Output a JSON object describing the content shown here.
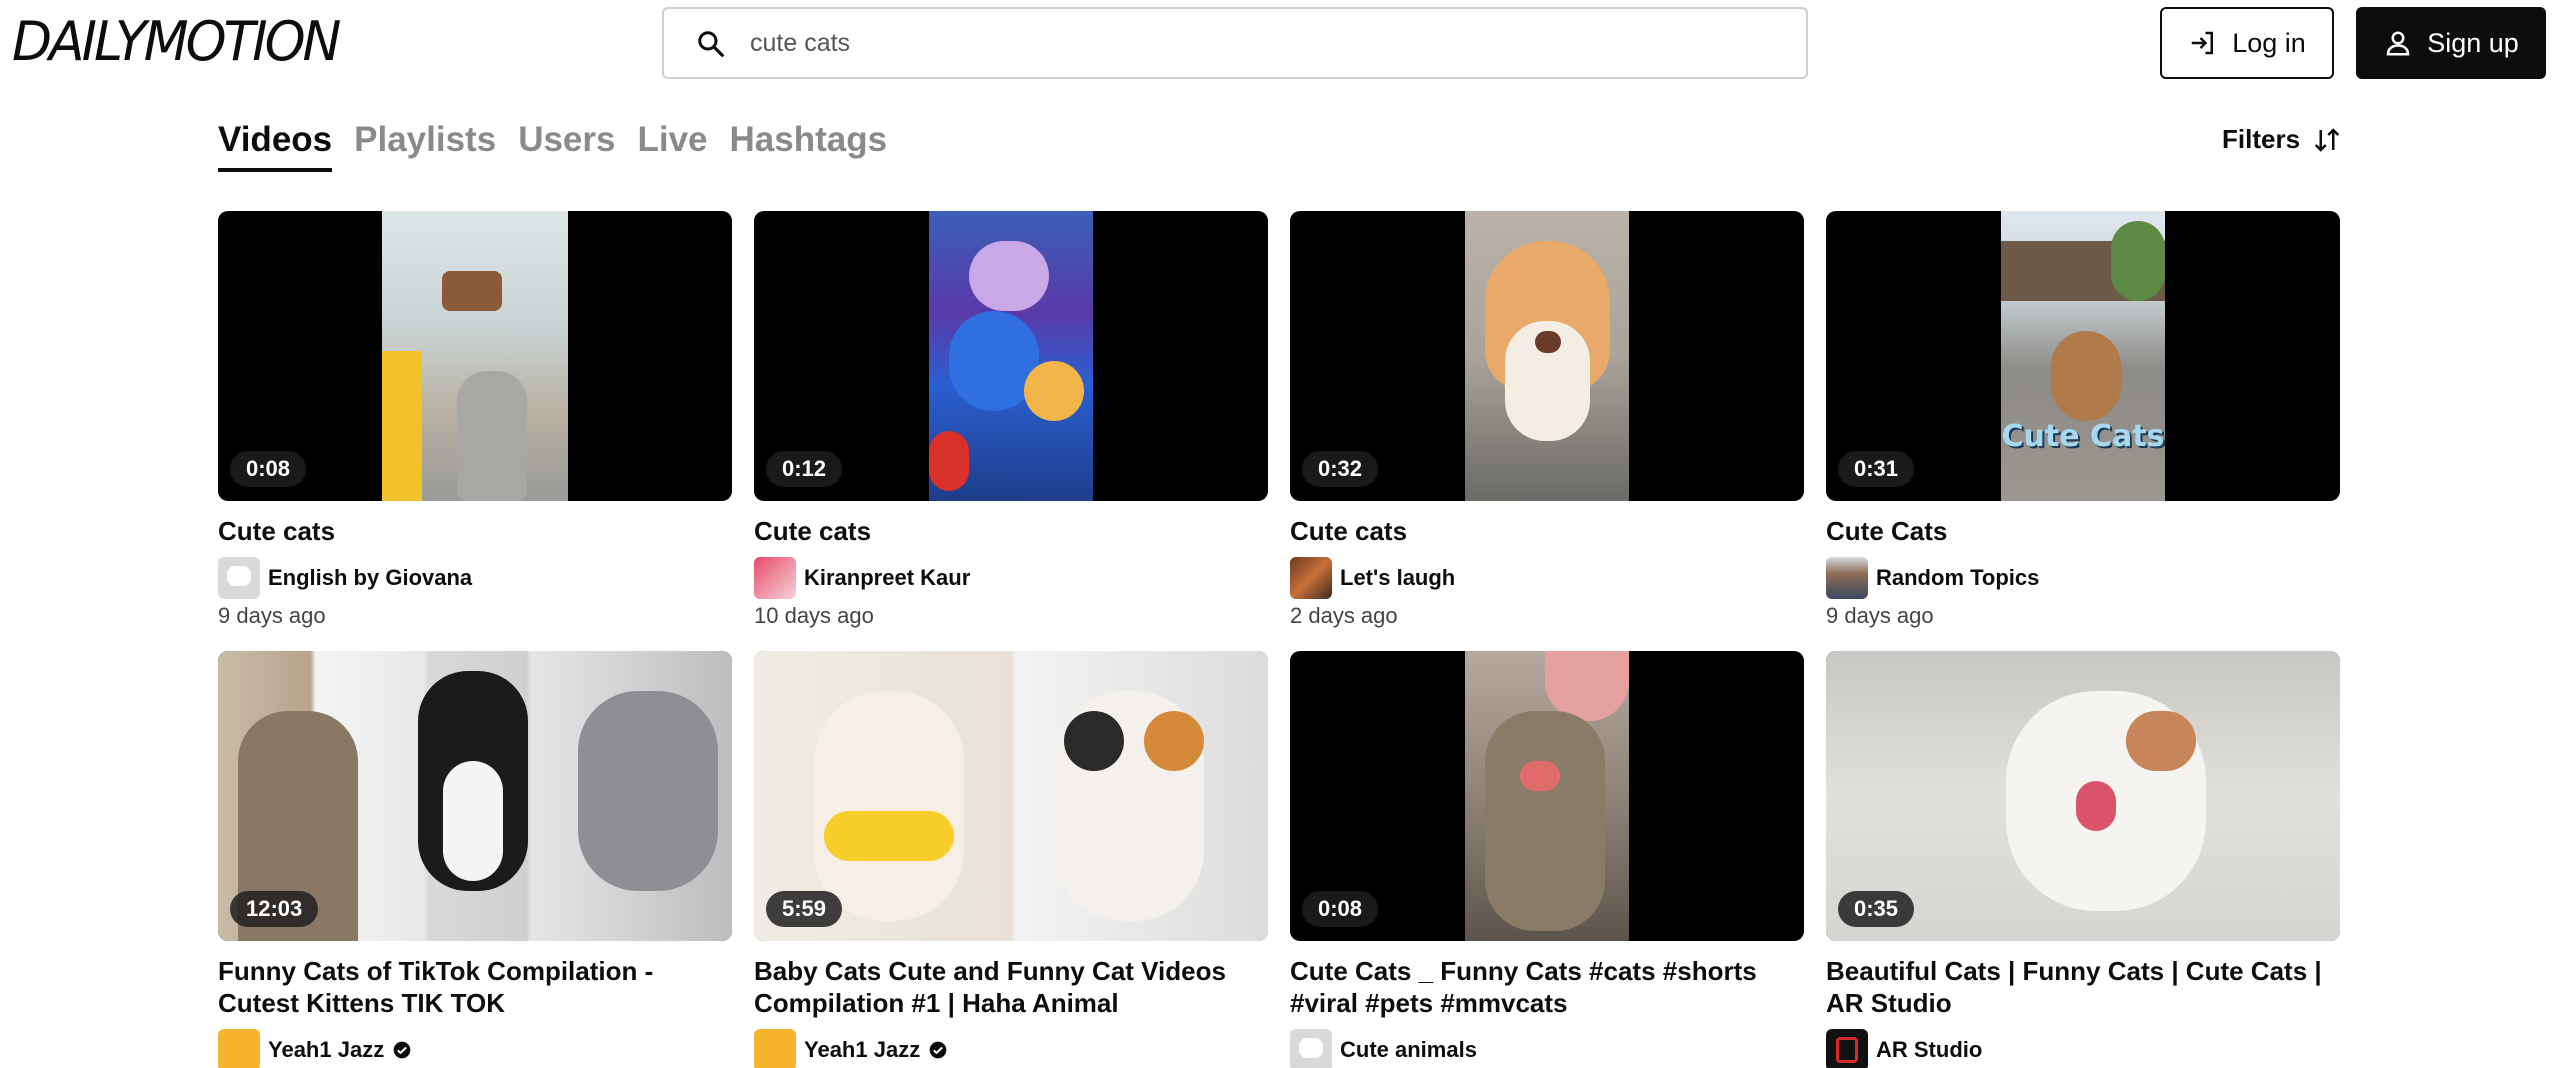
{
  "header": {
    "logo": "DAILYMOTION",
    "search": {
      "value": "cute cats",
      "placeholder": "Search"
    },
    "login_label": "Log in",
    "signup_label": "Sign up"
  },
  "tabs": [
    {
      "label": "Videos",
      "active": true
    },
    {
      "label": "Playlists",
      "active": false
    },
    {
      "label": "Users",
      "active": false
    },
    {
      "label": "Live",
      "active": false
    },
    {
      "label": "Hashtags",
      "active": false
    }
  ],
  "filters_label": "Filters",
  "videos": [
    {
      "duration": "0:08",
      "title": "Cute cats",
      "channel": "English by Giovana",
      "date": "9 days ago",
      "verified": false
    },
    {
      "duration": "0:12",
      "title": "Cute cats",
      "channel": "Kiranpreet Kaur",
      "date": "10 days ago",
      "verified": false
    },
    {
      "duration": "0:32",
      "title": "Cute cats",
      "channel": "Let's laugh",
      "date": "2 days ago",
      "verified": false
    },
    {
      "duration": "0:31",
      "title": "Cute Cats",
      "channel": "Random Topics",
      "date": "9 days ago",
      "verified": false,
      "thumb_text": "Cute Cats"
    },
    {
      "duration": "12:03",
      "title": "Funny Cats of TikTok Compilation - Cutest Kittens TIK TOK",
      "channel": "Yeah1 Jazz",
      "date": "",
      "verified": true
    },
    {
      "duration": "5:59",
      "title": "Baby Cats Cute and Funny Cat Videos Compilation #1 | Haha Animal",
      "channel": "Yeah1 Jazz",
      "date": "",
      "verified": true
    },
    {
      "duration": "0:08",
      "title": "Cute Cats _ Funny Cats #cats #shorts #viral #pets #mmvcats",
      "channel": "Cute animals",
      "date": "",
      "verified": false
    },
    {
      "duration": "0:35",
      "title": "Beautiful Cats | Funny Cats | Cute Cats | AR Studio",
      "channel": "AR Studio",
      "date": "",
      "verified": false
    }
  ],
  "colors": {
    "text": "#0d0d0d",
    "muted": "#8a8a8a",
    "border": "#cfcfcf"
  }
}
